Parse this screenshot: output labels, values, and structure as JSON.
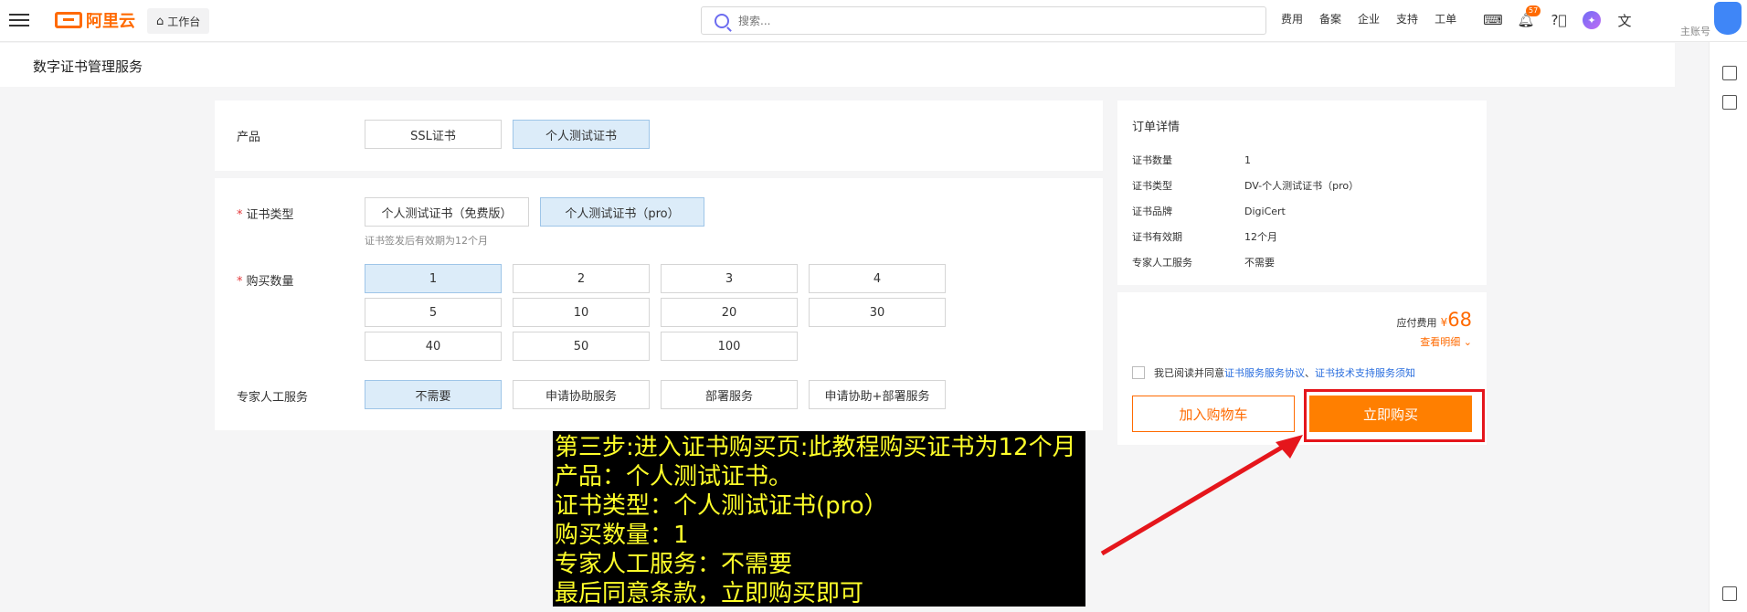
{
  "topbar": {
    "logo_text": "阿里云",
    "workbench_label": "工作台",
    "search_placeholder": "搜索...",
    "nav_links": [
      "费用",
      "备案",
      "企业",
      "支持",
      "工单"
    ],
    "bell_count": "57",
    "account_top": "",
    "account_label": "主账号"
  },
  "page": {
    "title": "数字证书管理服务"
  },
  "product": {
    "label": "产品",
    "options": [
      "SSL证书",
      "个人测试证书"
    ],
    "selected": "个人测试证书"
  },
  "config": {
    "cert_type_label": "证书类型",
    "cert_type_options": [
      "个人测试证书（免费版）",
      "个人测试证书（pro）"
    ],
    "cert_type_hint": "证书签发后有效期为12个月",
    "quantity_label": "购买数量",
    "quantity_options": [
      "1",
      "2",
      "3",
      "4",
      "5",
      "10",
      "20",
      "30",
      "40",
      "50",
      "100"
    ],
    "expert_label": "专家人工服务",
    "expert_options": [
      "不需要",
      "申请协助服务",
      "部署服务",
      "申请协助+部署服务"
    ]
  },
  "order": {
    "title": "订单详情",
    "rows": [
      {
        "key": "证书数量",
        "value": "1"
      },
      {
        "key": "证书类型",
        "value": "DV-个人测试证书（pro）"
      },
      {
        "key": "证书品牌",
        "value": "DigiCert"
      },
      {
        "key": "证书有效期",
        "value": "12个月"
      },
      {
        "key": "专家人工服务",
        "value": "不需要"
      }
    ],
    "fee_label": "应付费用",
    "currency": "¥",
    "price": "68",
    "detail_link": "查看明细",
    "agree_prefix": "我已阅读并同意",
    "agree_link1": "证书服务服务协议",
    "agree_sep": "、",
    "agree_link2": "证书技术支持服务须知",
    "cart_button": "加入购物车",
    "buy_button": "立即购买"
  },
  "annotation": {
    "lines": [
      "第三步:进入证书购买页:此教程购买证书为12个月",
      "产品：个人测试证书。",
      "证书类型：个人测试证书(pro）",
      "购买数量：1",
      "专家人工服务：不需要",
      "最后同意条款，立即购买即可"
    ]
  },
  "colors": {
    "brand": "#ff6a00",
    "selected_bg": "#dcecf9",
    "highlight": "#e5161c",
    "note_text": "#ffff2a"
  }
}
